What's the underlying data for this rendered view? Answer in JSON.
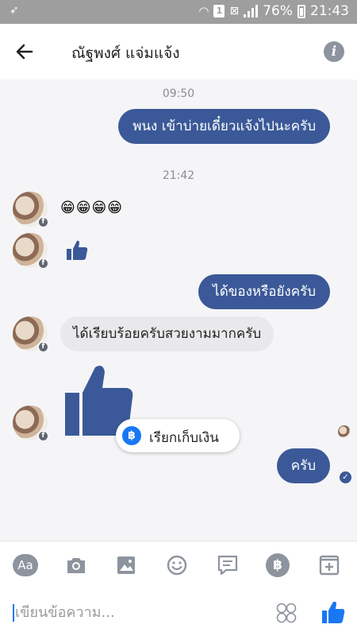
{
  "status_bar": {
    "battery": "76%",
    "time": "21:43",
    "sim_slot": "1"
  },
  "header": {
    "contact_name": "ณัฐพงศ์ แจ่มแจ้ง"
  },
  "messages": {
    "time_1": "09:50",
    "out_1": "พนง เข้าบ่ายเดี๋ยวแจ้งไปนะครับ",
    "time_2": "21:42",
    "in_emoji": "😁😁😁😁",
    "out_2": "ได้ของหรือยังครับ",
    "in_text": "ได้เรียบร้อยครับสวยงามมากครับ",
    "out_3": "ครับ"
  },
  "request_money": {
    "label": "เรียกเก็บเงิน",
    "icon_glyph": "฿"
  },
  "toolbar": {
    "text_button": "Aa",
    "payment_glyph": "฿"
  },
  "composer": {
    "placeholder": "เขียนข้อความ..."
  },
  "colors": {
    "accent": "#3b5998",
    "messenger_blue": "#1877f2",
    "incoming_bubble": "#e9e9eb"
  }
}
